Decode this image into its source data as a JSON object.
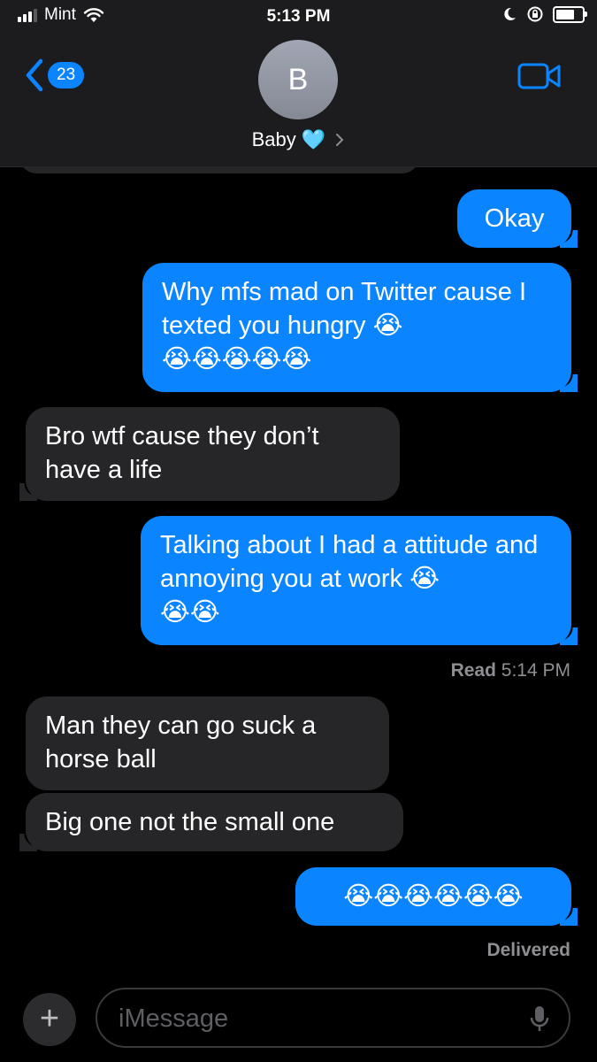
{
  "status_bar": {
    "carrier": "Mint",
    "time": "5:13 PM"
  },
  "header": {
    "back_count": "23",
    "avatar_initial": "B",
    "contact_name": "Baby",
    "contact_emoji": "🩵"
  },
  "messages": [
    {
      "dir": "out",
      "text": "Okay"
    },
    {
      "dir": "out",
      "text": "Why mfs mad on Twitter cause I texted you hungry 😭\n😭😭😭😭😭"
    },
    {
      "dir": "in",
      "text": "Bro wtf cause they don’t\nhave a life"
    },
    {
      "dir": "out",
      "text": "Talking about I had a attitude and annoying you at work 😭\n😭😭"
    },
    {
      "dir": "in",
      "text": "Man they can go suck a\nhorse ball"
    },
    {
      "dir": "in",
      "text": "Big one not the small one"
    },
    {
      "dir": "out",
      "text": "😭😭😭😭😭😭"
    }
  ],
  "read_receipt": {
    "label": "Read",
    "time": "5:14 PM"
  },
  "delivered_label": "Delivered",
  "composer": {
    "placeholder": "iMessage"
  },
  "colors": {
    "outgoing": "#0a84ff",
    "incoming": "#262629",
    "background": "#000000"
  }
}
